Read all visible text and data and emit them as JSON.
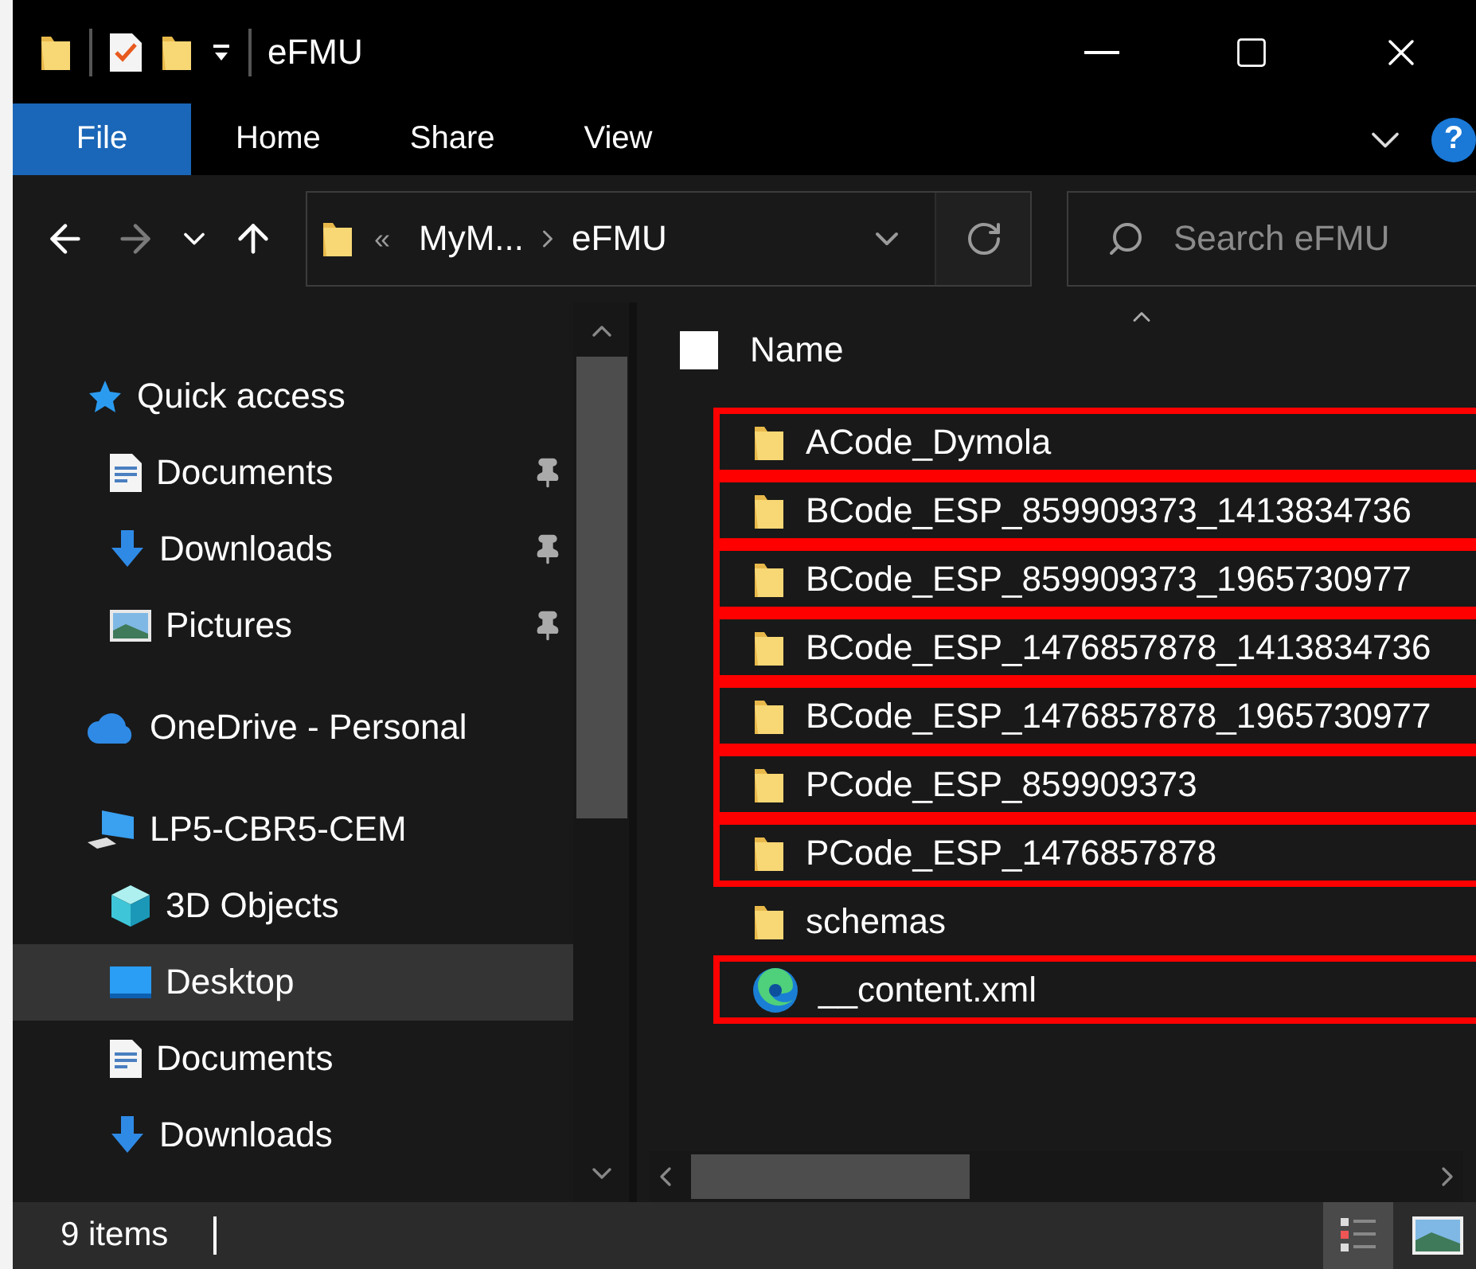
{
  "window": {
    "title": "eFMU"
  },
  "ribbon": {
    "tabs": [
      {
        "label": "File",
        "kind": "file"
      },
      {
        "label": "Home",
        "kind": "tab"
      },
      {
        "label": "Share",
        "kind": "tab"
      },
      {
        "label": "View",
        "kind": "tab"
      }
    ],
    "help": "?"
  },
  "navigation": {
    "forward_disabled": true
  },
  "address": {
    "overflow": "«",
    "crumbs": [
      "MyM...",
      "eFMU"
    ]
  },
  "search": {
    "placeholder": "Search eFMU"
  },
  "sidebar": {
    "items": [
      {
        "label": "Quick access",
        "kind": "star",
        "selected": false,
        "children": [
          {
            "label": "Documents",
            "kind": "document",
            "pinned": true,
            "selected": false
          },
          {
            "label": "Downloads",
            "kind": "download",
            "pinned": true,
            "selected": false
          },
          {
            "label": "Pictures",
            "kind": "pictures",
            "pinned": true,
            "selected": false
          }
        ]
      },
      {
        "label": "OneDrive - Personal",
        "kind": "cloud",
        "selected": false
      },
      {
        "label": "LP5-CBR5-CEM",
        "kind": "computer",
        "selected": false,
        "children": [
          {
            "label": "3D Objects",
            "kind": "cube",
            "pinned": false,
            "selected": false
          },
          {
            "label": "Desktop",
            "kind": "desktop",
            "pinned": false,
            "selected": true
          },
          {
            "label": "Documents",
            "kind": "document",
            "pinned": false,
            "selected": false
          },
          {
            "label": "Downloads",
            "kind": "download",
            "pinned": false,
            "selected": false
          }
        ]
      }
    ]
  },
  "file_list": {
    "select_all_checked": false,
    "columns": [
      "Name"
    ],
    "items": [
      {
        "name": "ACode_Dymola",
        "kind": "folder",
        "highlighted": true
      },
      {
        "name": "BCode_ESP_859909373_1413834736",
        "kind": "folder",
        "highlighted": true
      },
      {
        "name": "BCode_ESP_859909373_1965730977",
        "kind": "folder",
        "highlighted": true
      },
      {
        "name": "BCode_ESP_1476857878_1413834736",
        "kind": "folder",
        "highlighted": true
      },
      {
        "name": "BCode_ESP_1476857878_1965730977",
        "kind": "folder",
        "highlighted": true
      },
      {
        "name": "PCode_ESP_859909373",
        "kind": "folder",
        "highlighted": true
      },
      {
        "name": "PCode_ESP_1476857878",
        "kind": "folder",
        "highlighted": true
      },
      {
        "name": "schemas",
        "kind": "folder",
        "highlighted": false
      },
      {
        "name": "__content.xml",
        "kind": "xml",
        "highlighted": true
      }
    ]
  },
  "status_bar": {
    "count": "9 items",
    "views": [
      {
        "kind": "details",
        "selected": true
      },
      {
        "kind": "large_icons",
        "selected": false
      }
    ]
  }
}
